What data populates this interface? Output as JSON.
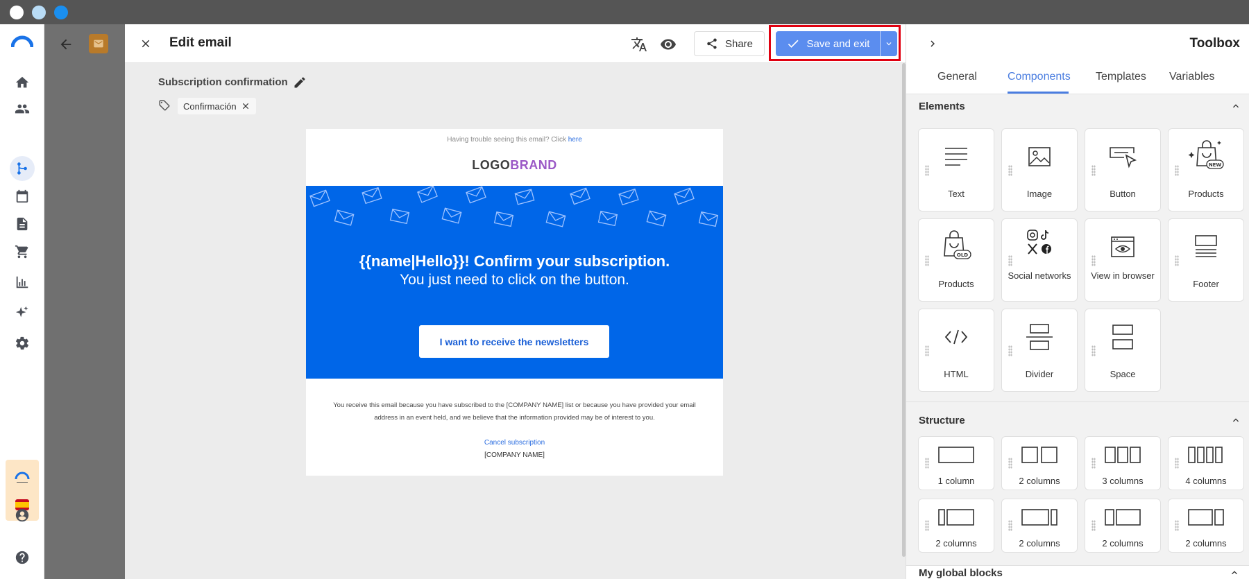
{
  "window": {
    "dot_colors": [
      "#ffffff",
      "#b9dcf6",
      "#1a8ff0"
    ]
  },
  "nav": {
    "items": [
      "home-icon",
      "contacts-icon",
      "automation-icon",
      "calendar-icon",
      "document-icon",
      "cart-icon",
      "reports-icon",
      "ai-sparkle-icon",
      "settings-icon"
    ],
    "bottom": [
      "account-icon",
      "help-icon"
    ],
    "flag_box_color": "#fde6c6"
  },
  "editor": {
    "title": "Edit email",
    "email_name": "Subscription confirmation",
    "tag": "Confirmación",
    "share_label": "Share",
    "save_label": "Save and exit",
    "accent": "#5b8def",
    "highlight_color": "#e00010"
  },
  "email": {
    "preheader_text": "Having trouble seeing this email? Click",
    "preheader_link": "here",
    "logo_part1": "LOGO",
    "logo_part2": "BRAND",
    "hero_title": "{{name|Hello}}! Confirm your subscription.",
    "hero_subtitle": "You just need to click on the button.",
    "cta_label": "I want to receive the newsletters",
    "footer_text_line1": "You receive this email because you have subscribed to the [COMPANY NAME] list or because you have provided your email",
    "footer_text_line2": "address in an event held, and we believe that the information provided may be of interest to you.",
    "cancel_link": "Cancel subscription",
    "company": "[COMPANY NAME]",
    "hero_color": "#0066e8",
    "brand_color": "#9b59c6"
  },
  "toolbox": {
    "title": "Toolbox",
    "tabs": [
      {
        "label": "General"
      },
      {
        "label": "Components"
      },
      {
        "label": "Templates"
      },
      {
        "label": "Variables"
      }
    ],
    "active_tab": "Components",
    "elements_title": "Elements",
    "elements": [
      {
        "label": "Text",
        "icon": "text-lines-icon"
      },
      {
        "label": "Image",
        "icon": "image-icon"
      },
      {
        "label": "Button",
        "icon": "button-cursor-icon"
      },
      {
        "label": "Products",
        "icon": "products-new-icon"
      },
      {
        "label": "Products",
        "icon": "products-old-icon"
      },
      {
        "label": "Social networks",
        "icon": "social-networks-icon"
      },
      {
        "label": "View in browser",
        "icon": "view-browser-icon"
      },
      {
        "label": "Footer",
        "icon": "footer-icon"
      },
      {
        "label": "HTML",
        "icon": "html-code-icon"
      },
      {
        "label": "Divider",
        "icon": "divider-icon"
      },
      {
        "label": "Space",
        "icon": "space-icon"
      }
    ],
    "structure_title": "Structure",
    "structures": [
      {
        "label": "1 column",
        "icon": "layout-1-column-icon"
      },
      {
        "label": "2 columns",
        "icon": "layout-2-columns-icon"
      },
      {
        "label": "3 columns",
        "icon": "layout-3-columns-icon"
      },
      {
        "label": "4 columns",
        "icon": "layout-4-columns-icon"
      },
      {
        "label": "2 columns",
        "icon": "layout-2-columns-left-narrow-icon"
      },
      {
        "label": "2 columns",
        "icon": "layout-2-columns-right-narrow-icon"
      },
      {
        "label": "2 columns",
        "icon": "layout-2-columns-left-small-icon"
      },
      {
        "label": "2 columns",
        "icon": "layout-2-columns-right-small-icon"
      }
    ],
    "global_blocks_title": "My global blocks"
  }
}
